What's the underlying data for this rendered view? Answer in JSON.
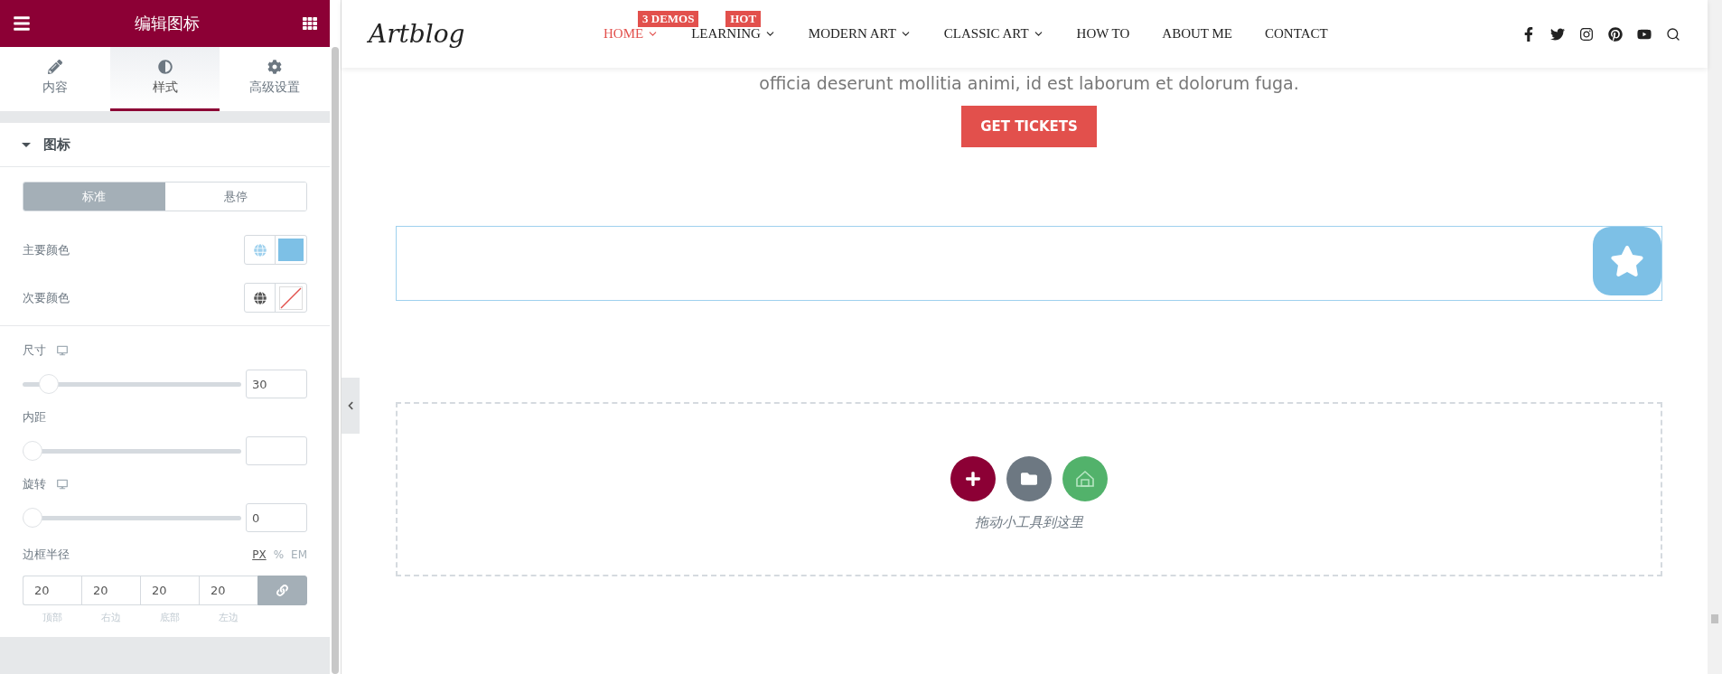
{
  "panel": {
    "title": "编辑图标",
    "tabs": [
      {
        "label": "内容",
        "selected": false
      },
      {
        "label": "样式",
        "selected": true
      },
      {
        "label": "高级设置",
        "selected": false
      }
    ],
    "section": {
      "title": "图标",
      "expanded": true
    },
    "state_toggle": [
      {
        "label": "标准",
        "selected": true
      },
      {
        "label": "悬停",
        "selected": false
      }
    ],
    "colors": [
      {
        "label": "主要颜色",
        "color": "#7dc0e6"
      },
      {
        "label": "次要颜色"
      }
    ],
    "sliders": [
      {
        "label": "尺寸",
        "responsive": true,
        "level": 0.08,
        "value": "30"
      },
      {
        "label": "内距",
        "responsive": false,
        "level": 0
      },
      {
        "label": "旋转",
        "responsive": true,
        "level": 0,
        "value": "0"
      }
    ],
    "border_radius": {
      "label": "边框半径",
      "units": [
        {
          "label": "PX",
          "selected": true
        },
        {
          "label": "%",
          "selected": false
        },
        {
          "label": "EM",
          "selected": false
        }
      ],
      "fields": [
        {
          "value": "20",
          "caption": "顶部"
        },
        {
          "value": "20",
          "caption": "右边"
        },
        {
          "value": "20",
          "caption": "底部"
        },
        {
          "value": "20",
          "caption": "左边"
        }
      ],
      "linked": true
    }
  },
  "site": {
    "logo": "Artblog",
    "nav": [
      {
        "label": "HOME",
        "dropdown": true,
        "selected": true,
        "badge": "3 DEMOS"
      },
      {
        "label": "LEARNING",
        "dropdown": true,
        "selected": false,
        "badge": "HOT"
      },
      {
        "label": "MODERN ART",
        "dropdown": true,
        "selected": false
      },
      {
        "label": "CLASSIC ART",
        "dropdown": true,
        "selected": false
      },
      {
        "label": "HOW TO",
        "dropdown": false,
        "selected": false
      },
      {
        "label": "ABOUT ME",
        "dropdown": false,
        "selected": false
      },
      {
        "label": "CONTACT",
        "dropdown": false,
        "selected": false
      }
    ],
    "body_text": "officia deserunt mollitia animi, id est laborum et dolorum fuga.",
    "cta": "GET TICKETS",
    "dropzone": {
      "hint": "拖动小工具到这里"
    }
  }
}
